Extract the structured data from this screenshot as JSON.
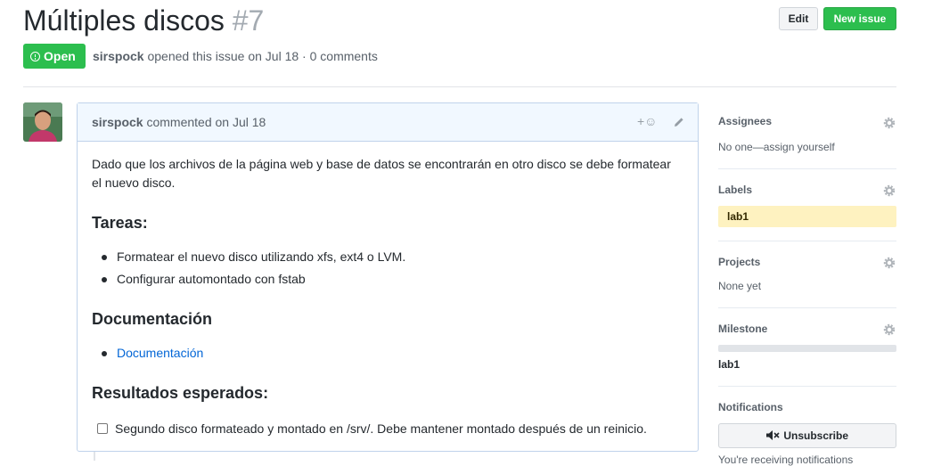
{
  "issue": {
    "title": "Múltiples discos",
    "number": "#7",
    "state": "Open",
    "author": "sirspock",
    "opened_text": "opened this issue on Jul 18 · 0 comments"
  },
  "header_buttons": {
    "edit": "Edit",
    "new_issue": "New issue"
  },
  "comment": {
    "author": "sirspock",
    "action": "commented on Jul 18",
    "reaction_glyph": "+☺",
    "intro": "Dado que los archivos de la página web y base de datos se encontrarán en otro disco se debe formatear el nuevo disco.",
    "section1_title": "Tareas:",
    "tasks": [
      "Formatear el nuevo disco utilizando xfs, ext4 o LVM.",
      "Configurar automontado con fstab"
    ],
    "section2_title": "Documentación",
    "doc_link": "Documentación",
    "section3_title": "Resultados esperados:",
    "expected_task": "Segundo disco formateado y montado en /srv/. Debe mantener montado después de un reinicio."
  },
  "sidebar": {
    "assignees": {
      "title": "Assignees",
      "value": "No one—assign yourself"
    },
    "labels": {
      "title": "Labels",
      "label": "lab1",
      "label_color": "#fef2c0"
    },
    "projects": {
      "title": "Projects",
      "value": "None yet"
    },
    "milestone": {
      "title": "Milestone",
      "value": "lab1",
      "progress": 0
    },
    "notifications": {
      "title": "Notifications",
      "button": "Unsubscribe",
      "note": "You're receiving notifications"
    }
  },
  "colors": {
    "open_green": "#2cbe4e",
    "link_blue": "#0366d6",
    "comment_header": "#f1f8ff"
  },
  "icons": [
    "open-issue-icon",
    "smiley-icon",
    "pencil-icon",
    "gear-icon",
    "mute-icon"
  ]
}
